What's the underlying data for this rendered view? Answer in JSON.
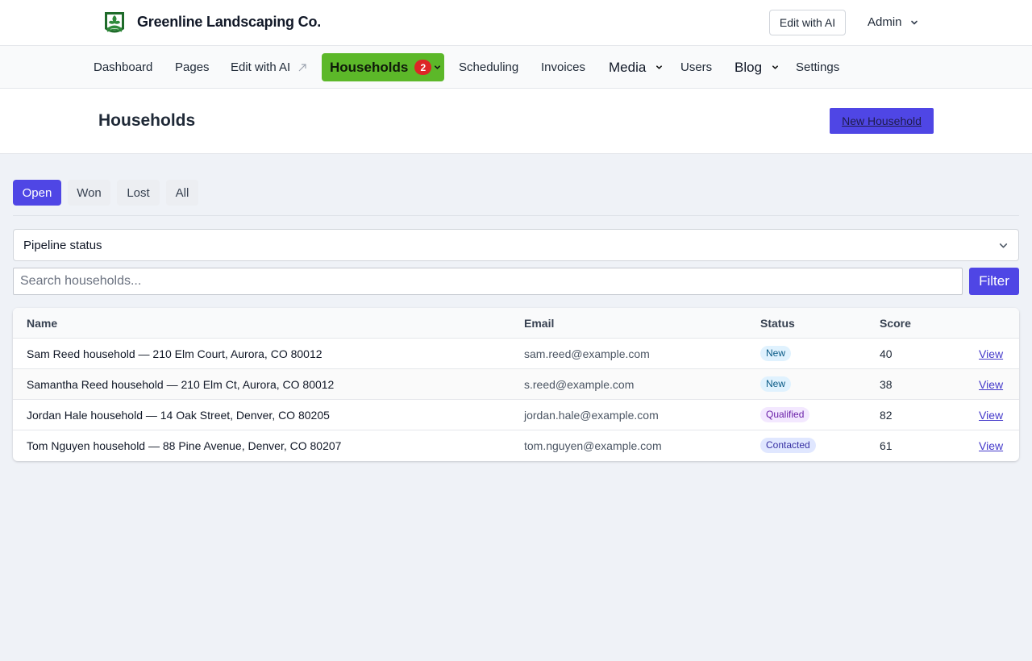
{
  "brand": {
    "name": "Greenline Landscaping Co."
  },
  "topbar": {
    "edit_ai_label": "Edit with AI",
    "admin_label": "Admin"
  },
  "nav": {
    "dashboard": "Dashboard",
    "pages": "Pages",
    "edit_ai": "Edit with AI",
    "households": "Households",
    "households_badge": "2",
    "scheduling": "Scheduling",
    "invoices": "Invoices",
    "media": "Media",
    "users": "Users",
    "blog": "Blog",
    "settings": "Settings"
  },
  "page": {
    "title": "Households",
    "new_button": "New Household"
  },
  "tabs": [
    "Open",
    "Won",
    "Lost",
    "All"
  ],
  "active_tab": "Open",
  "filters": {
    "pipeline_status": "Pipeline status",
    "search_placeholder": "Search households...",
    "filter_button": "Filter"
  },
  "table": {
    "columns": [
      "Name",
      "Email",
      "Status",
      "Score"
    ],
    "rows": [
      {
        "name": "Sam Reed household — 210 Elm Court, Aurora, CO 80012",
        "email": "sam.reed@example.com",
        "status": "New",
        "score": "40",
        "action": "View"
      },
      {
        "name": "Samantha Reed household — 210 Elm Ct, Aurora, CO 80012",
        "email": "s.reed@example.com",
        "status": "New",
        "score": "38",
        "action": "View"
      },
      {
        "name": "Jordan Hale household — 14 Oak Street, Denver, CO 80205",
        "email": "jordan.hale@example.com",
        "status": "Qualified",
        "score": "82",
        "action": "View"
      },
      {
        "name": "Tom Nguyen household — 88 Pine Avenue, Denver, CO 80207",
        "email": "tom.nguyen@example.com",
        "status": "Contacted",
        "score": "61",
        "action": "View"
      }
    ]
  },
  "colors": {
    "primary": "#4f46e5",
    "nav_active": "#5cb829",
    "badge": "#dc2626"
  }
}
